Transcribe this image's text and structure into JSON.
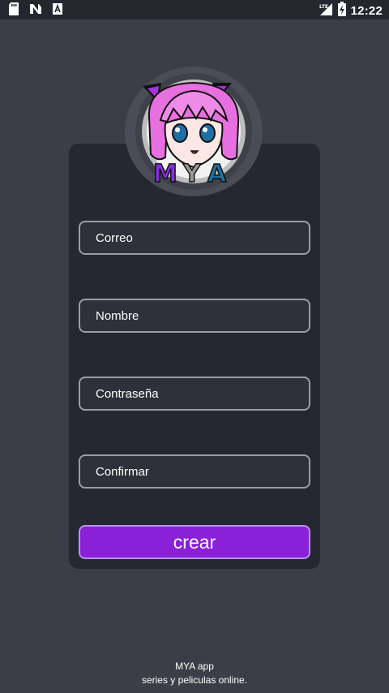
{
  "status_bar": {
    "time": "12:22",
    "network": "LTE",
    "left_icons": [
      "sd-card-icon",
      "n-notification-icon",
      "a-notification-icon"
    ],
    "right_icons": [
      "lte-signal-icon",
      "battery-charging-icon"
    ]
  },
  "logo": {
    "text": "MYA",
    "icon": "anime-girl-avatar"
  },
  "form": {
    "email_placeholder": "Correo",
    "name_placeholder": "Nombre",
    "password_placeholder": "Contraseña",
    "confirm_placeholder": "Confirmar",
    "submit_label": "crear"
  },
  "footer": {
    "line1": "MYA app",
    "line2": "series y peliculas online."
  },
  "colors": {
    "background": "#3b3e47",
    "card": "#252830",
    "status_bar": "#24272e",
    "accent": "#8a20d8"
  }
}
